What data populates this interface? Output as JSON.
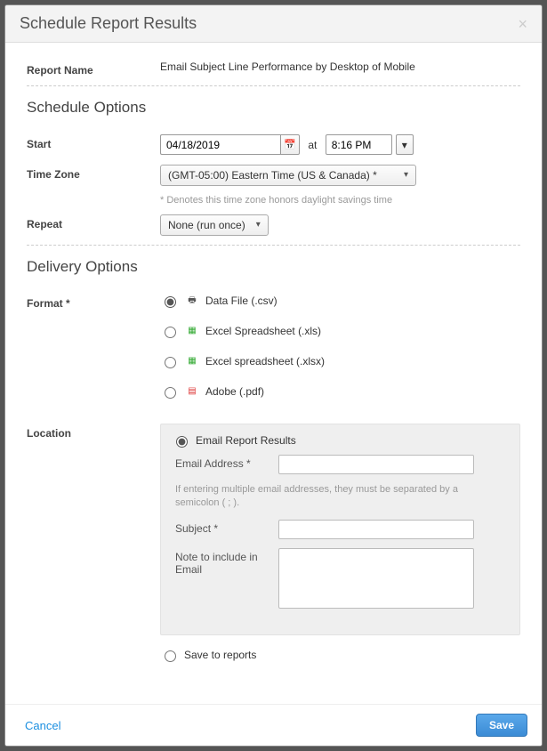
{
  "header": {
    "title": "Schedule Report Results",
    "close_label": "×"
  },
  "report_name": {
    "label": "Report Name",
    "value": "Email Subject Line Performance by Desktop of Mobile"
  },
  "schedule": {
    "section_title": "Schedule Options",
    "start_label": "Start",
    "start_date": "04/18/2019",
    "at_text": "at",
    "start_time": "8:16 PM",
    "tz_label": "Time Zone",
    "tz_value": "(GMT-05:00) Eastern Time (US & Canada) *",
    "tz_hint": "* Denotes this time zone honors daylight savings time",
    "repeat_label": "Repeat",
    "repeat_value": "None (run once)"
  },
  "delivery": {
    "section_title": "Delivery Options",
    "format_label": "Format *",
    "formats": [
      {
        "label": "Data File (.csv)",
        "checked": true
      },
      {
        "label": "Excel Spreadsheet (.xls)",
        "checked": false
      },
      {
        "label": "Excel spreadsheet (.xlsx)",
        "checked": false
      },
      {
        "label": "Adobe (.pdf)",
        "checked": false
      }
    ],
    "location_label": "Location",
    "email_option_label": "Email Report Results",
    "email_address_label": "Email Address *",
    "email_address_value": "",
    "email_hint": "If entering multiple email addresses, they must be separated by a semicolon ( ; ).",
    "subject_label": "Subject *",
    "subject_value": "",
    "note_label": "Note to include in Email",
    "note_value": "",
    "save_option_label": "Save to reports"
  },
  "footer": {
    "cancel": "Cancel",
    "save": "Save"
  }
}
